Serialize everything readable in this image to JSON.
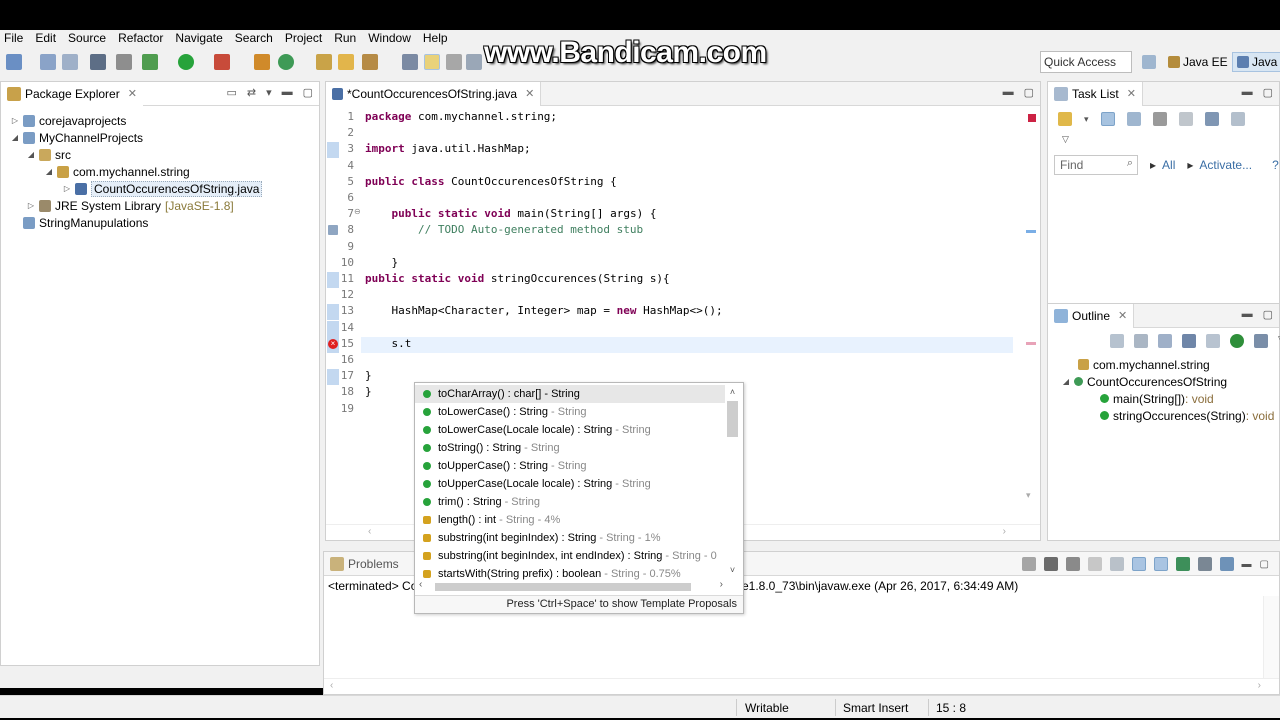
{
  "watermark": "www.Bandicam.com",
  "menu": [
    "File",
    "Edit",
    "Source",
    "Refactor",
    "Navigate",
    "Search",
    "Project",
    "Run",
    "Window",
    "Help"
  ],
  "quick_access": "Quick Access",
  "perspectives": {
    "java_ee": "Java EE",
    "java": "Java"
  },
  "package_explorer": {
    "title": "Package Explorer",
    "items": [
      {
        "label": "corejavaprojects"
      },
      {
        "label": "MyChannelProjects"
      },
      {
        "label": "src"
      },
      {
        "label": "com.mychannel.string"
      },
      {
        "label": "CountOccurencesOfString.java"
      },
      {
        "label": "JRE System Library",
        "suffix": "[JavaSE-1.8]"
      },
      {
        "label": "StringManupulations"
      }
    ]
  },
  "editor": {
    "tab_title": "*CountOccurencesOfString.java",
    "lines": [
      {
        "n": "1",
        "parts": [
          {
            "t": "package",
            "c": "kw"
          },
          {
            "t": " com.mychannel.string;"
          }
        ]
      },
      {
        "n": "2",
        "parts": []
      },
      {
        "n": "3",
        "parts": [
          {
            "t": "import",
            "c": "kw"
          },
          {
            "t": " java.util.HashMap;"
          }
        ]
      },
      {
        "n": "4",
        "parts": []
      },
      {
        "n": "5",
        "parts": [
          {
            "t": "public",
            "c": "kw"
          },
          {
            "t": " "
          },
          {
            "t": "class",
            "c": "kw"
          },
          {
            "t": " CountOccurencesOfString {"
          }
        ]
      },
      {
        "n": "6",
        "parts": []
      },
      {
        "n": "7",
        "parts": [
          {
            "t": "    "
          },
          {
            "t": "public",
            "c": "kw"
          },
          {
            "t": " "
          },
          {
            "t": "static",
            "c": "kw"
          },
          {
            "t": " "
          },
          {
            "t": "void",
            "c": "kw"
          },
          {
            "t": " main(String[] args) {"
          }
        ]
      },
      {
        "n": "8",
        "parts": [
          {
            "t": "        "
          },
          {
            "t": "// TODO Auto-generated method stub",
            "c": "cm"
          }
        ]
      },
      {
        "n": "9",
        "parts": []
      },
      {
        "n": "10",
        "parts": [
          {
            "t": "    }"
          }
        ]
      },
      {
        "n": "11",
        "parts": [
          {
            "t": "public",
            "c": "kw"
          },
          {
            "t": " "
          },
          {
            "t": "static",
            "c": "kw"
          },
          {
            "t": " "
          },
          {
            "t": "void",
            "c": "kw"
          },
          {
            "t": " stringOccurences(String s){"
          }
        ]
      },
      {
        "n": "12",
        "parts": []
      },
      {
        "n": "13",
        "parts": [
          {
            "t": "    HashMap<Character, Integer> map = "
          },
          {
            "t": "new",
            "c": "kw"
          },
          {
            "t": " HashMap<>();"
          }
        ]
      },
      {
        "n": "14",
        "parts": []
      },
      {
        "n": "15",
        "parts": [
          {
            "t": "    s.t"
          }
        ]
      },
      {
        "n": "16",
        "parts": []
      },
      {
        "n": "17",
        "parts": [
          {
            "t": "}"
          }
        ]
      },
      {
        "n": "18",
        "parts": [
          {
            "t": "}"
          }
        ]
      },
      {
        "n": "19",
        "parts": []
      }
    ]
  },
  "completion": {
    "items": [
      {
        "sig": "toCharArray() : char[] - String",
        "type": "",
        "icon": "public"
      },
      {
        "sig": "toLowerCase() : String",
        "type": "- String",
        "icon": "public"
      },
      {
        "sig": "toLowerCase(Locale locale) : String",
        "type": "- String",
        "icon": "public"
      },
      {
        "sig": "toString() : String",
        "type": "- String",
        "icon": "public"
      },
      {
        "sig": "toUpperCase() : String",
        "type": "- String",
        "icon": "public"
      },
      {
        "sig": "toUpperCase(Locale locale) : String",
        "type": "- String",
        "icon": "public"
      },
      {
        "sig": "trim() : String",
        "type": "- String",
        "icon": "public"
      },
      {
        "sig": "length() : int",
        "type": "- String - 4%",
        "icon": "lightbulb"
      },
      {
        "sig": "substring(int beginIndex) : String",
        "type": "- String - 1%",
        "icon": "lightbulb"
      },
      {
        "sig": "substring(int beginIndex, int endIndex) : String",
        "type": "- String - 0",
        "icon": "lightbulb"
      },
      {
        "sig": "startsWith(String prefix) : boolean",
        "type": "- String - 0.75%",
        "icon": "lightbulb"
      }
    ],
    "footer": "Press 'Ctrl+Space' to show Template Proposals"
  },
  "task_list": {
    "title": "Task List",
    "find_placeholder": "Find",
    "all": "All",
    "activate": "Activate..."
  },
  "outline": {
    "title": "Outline",
    "items": [
      {
        "label": "com.mychannel.string"
      },
      {
        "label": "CountOccurencesOfString"
      },
      {
        "label": "main(String[])",
        "type": " : void"
      },
      {
        "label": "stringOccurences(String)",
        "type": " : void"
      }
    ]
  },
  "console": {
    "problems_tab": "Problems",
    "terminated": "<terminated> Co",
    "path_tail": "re1.8.0_73\\bin\\javaw.exe (Apr 26, 2017, 6:34:49 AM)"
  },
  "status": {
    "writable": "Writable",
    "insert": "Smart Insert",
    "position": "15 : 8"
  },
  "colors": {
    "keyword": "#7f0055",
    "comment": "#3f7f5f",
    "error": "#e02020",
    "selection": "#e8f2fe"
  }
}
